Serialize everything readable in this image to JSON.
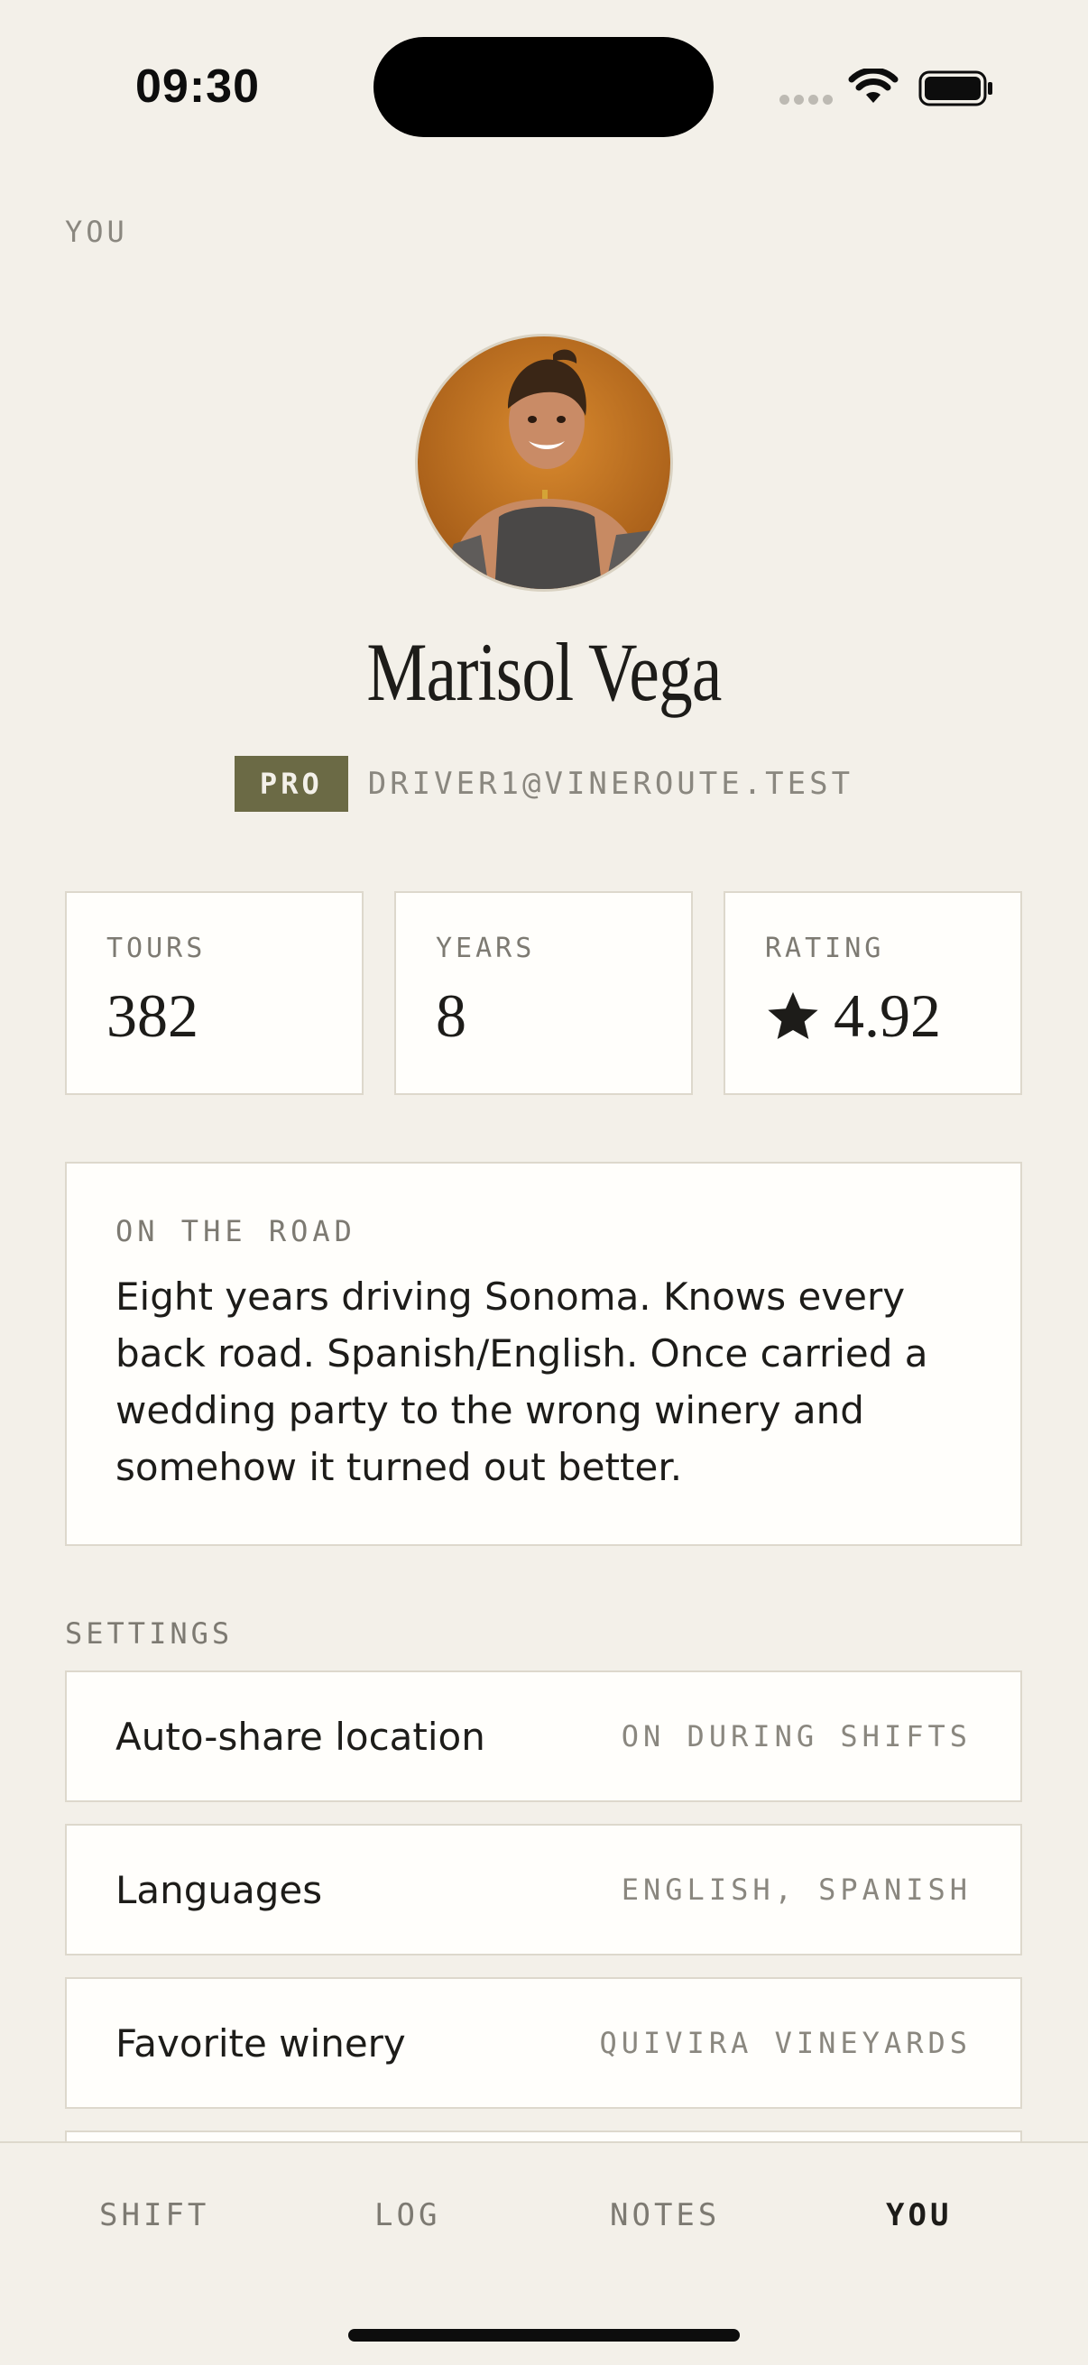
{
  "status": {
    "time": "09:30"
  },
  "page": {
    "label": "YOU"
  },
  "profile": {
    "name": "Marisol Vega",
    "badge": "PRO",
    "email": "DRIVER1@VINEROUTE.TEST"
  },
  "stats": [
    {
      "label": "TOURS",
      "value": "382"
    },
    {
      "label": "YEARS",
      "value": "8"
    },
    {
      "label": "RATING",
      "value": "4.92",
      "icon": "star-icon"
    }
  ],
  "bio": {
    "label": "ON THE ROAD",
    "text": "Eight years driving Sonoma. Knows every back road. Spanish/English. Once carried a wedding party to the wrong winery and somehow it turned out better."
  },
  "settings": {
    "label": "SETTINGS",
    "items": [
      {
        "name": "Auto-share location",
        "value": "ON DURING SHIFTS"
      },
      {
        "name": "Languages",
        "value": "ENGLISH, SPANISH"
      },
      {
        "name": "Favorite winery",
        "value": "QUIVIRA VINEYARDS"
      }
    ]
  },
  "tabs": [
    {
      "label": "SHIFT"
    },
    {
      "label": "LOG"
    },
    {
      "label": "NOTES"
    },
    {
      "label": "YOU"
    }
  ],
  "colors": {
    "background": "#f3f0e9",
    "card": "#fffefb",
    "badge": "#6b6a45",
    "muted": "#8a877f"
  }
}
